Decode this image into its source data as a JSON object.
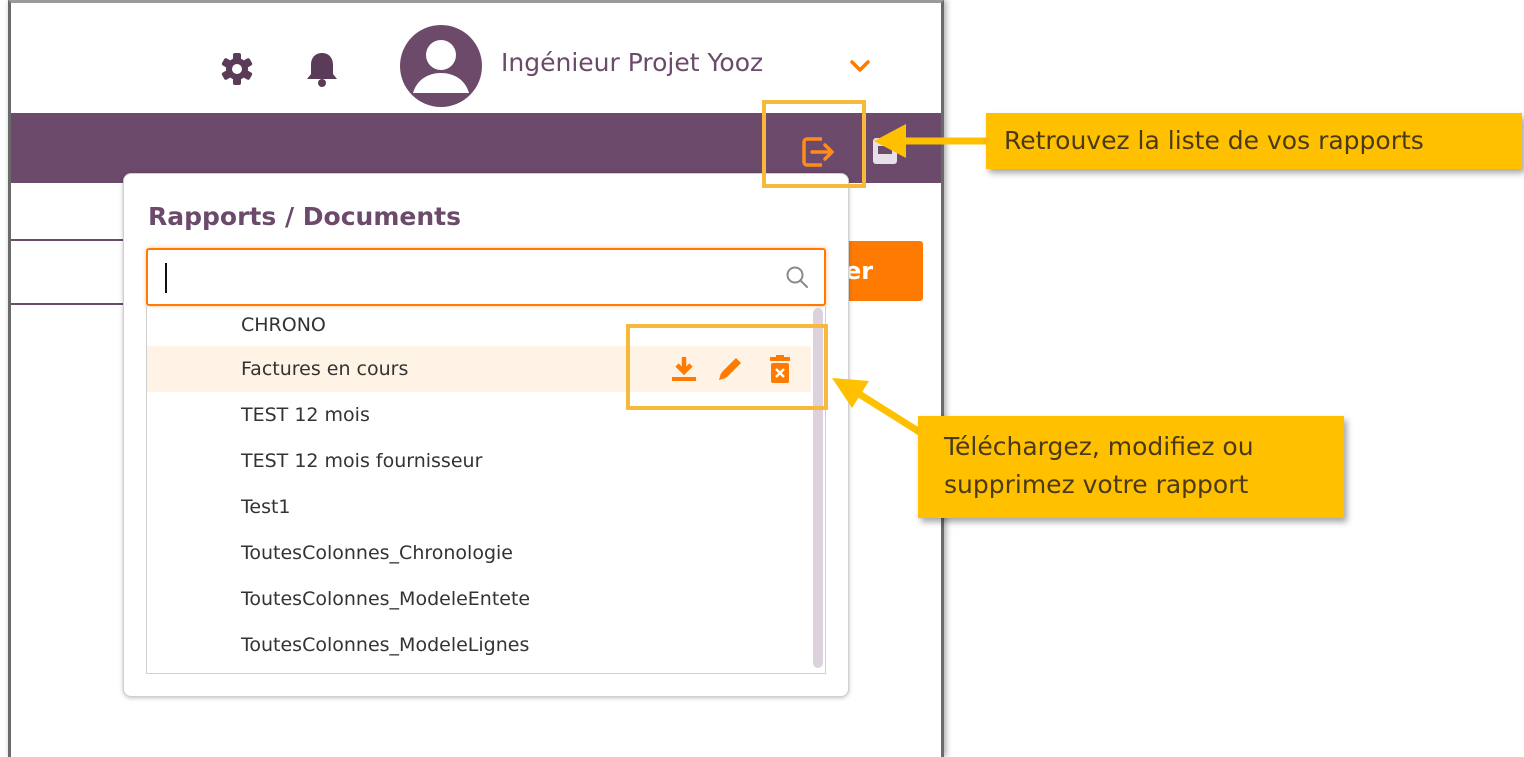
{
  "header": {
    "user_name": "Ingénieur Projet Yooz",
    "icons": [
      "gear-icon",
      "bell-icon",
      "avatar-icon",
      "chevron-down-icon",
      "export-icon",
      "print-icon"
    ]
  },
  "background": {
    "button_partial_label": "er"
  },
  "panel": {
    "title": "Rapports / Documents",
    "search_value": "",
    "items": [
      {
        "label": "CHRONO"
      },
      {
        "label": "Factures en cours"
      },
      {
        "label": "TEST 12 mois"
      },
      {
        "label": "TEST 12 mois fournisseur"
      },
      {
        "label": "Test1"
      },
      {
        "label": "ToutesColonnes_Chronologie"
      },
      {
        "label": "ToutesColonnes_ModeleEntete"
      },
      {
        "label": "ToutesColonnes_ModeleLignes"
      }
    ],
    "row_actions": [
      "download-icon",
      "edit-icon",
      "delete-icon"
    ]
  },
  "annotations": {
    "reports_list": "Retrouvez la liste de vos rapports",
    "actions_line1": "Téléchargez, modifiez ou",
    "actions_line2": "supprimez votre rapport"
  },
  "colors": {
    "brand_purple": "#6b4a6b",
    "accent_orange": "#ff7a00",
    "callout_yellow": "#ffc000",
    "highlight_border": "#f6b93b"
  }
}
